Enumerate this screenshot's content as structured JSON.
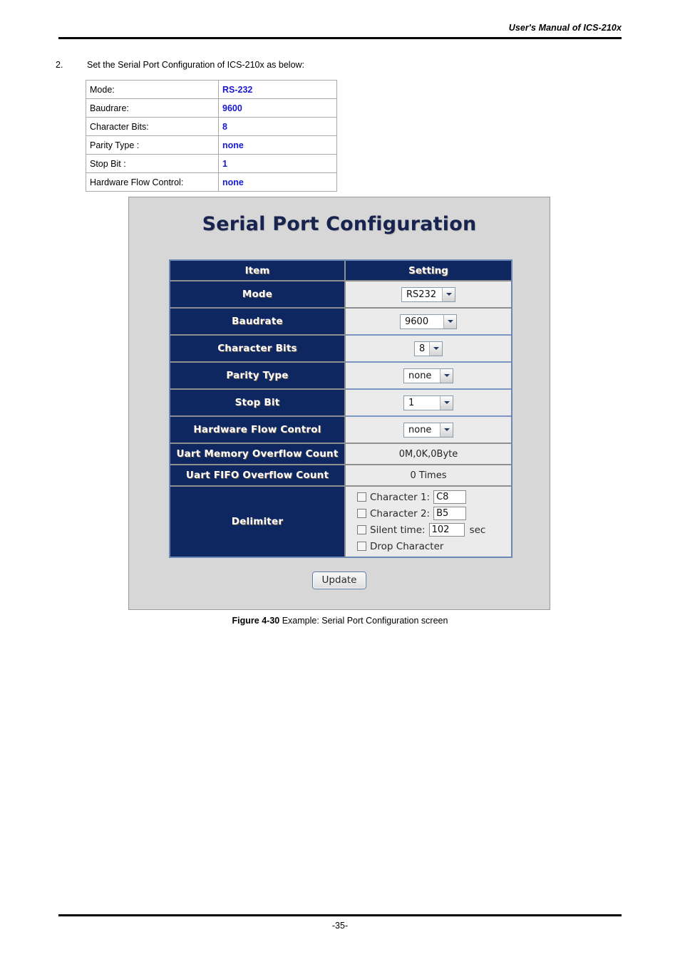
{
  "header": {
    "manual_title": "User's Manual of ICS-210x"
  },
  "step": {
    "number": "2.",
    "text": "Set the Serial Port Configuration of ICS-210x as below:"
  },
  "summary_table": {
    "rows": [
      {
        "label": "Mode:",
        "value": "RS-232"
      },
      {
        "label": "Baudrare:",
        "value": "9600"
      },
      {
        "label": "Character Bits:",
        "value": "8"
      },
      {
        "label": "Parity Type :",
        "value": "none"
      },
      {
        "label": "Stop Bit :",
        "value": "1"
      },
      {
        "label": "Hardware Flow Control:",
        "value": "none"
      }
    ]
  },
  "screenshot": {
    "title": "Serial Port Configuration",
    "columns": {
      "item": "Item",
      "setting": "Setting"
    },
    "rows": {
      "mode": {
        "label": "Mode",
        "value": "RS232"
      },
      "baudrate": {
        "label": "Baudrate",
        "value": "9600"
      },
      "character_bits": {
        "label": "Character Bits",
        "value": "8"
      },
      "parity_type": {
        "label": "Parity Type",
        "value": "none"
      },
      "stop_bit": {
        "label": "Stop Bit",
        "value": "1"
      },
      "hardware_flow_control": {
        "label": "Hardware Flow Control",
        "value": "none"
      },
      "uart_memory_overflow": {
        "label": "Uart Memory Overflow Count",
        "value": "0M,0K,0Byte"
      },
      "uart_fifo_overflow": {
        "label": "Uart FIFO Overflow Count",
        "value": "0 Times"
      },
      "delimiter": {
        "label": "Delimiter",
        "character1_label": "Character 1:",
        "character1_value": "C8",
        "character2_label": "Character 2:",
        "character2_value": "B5",
        "silent_time_label": "Silent time:",
        "silent_time_value": "102",
        "silent_time_unit": "sec",
        "drop_character_label": "Drop Character"
      }
    },
    "update_button": "Update",
    "colors": {
      "header_navy": "#0f2760",
      "setting_bg": "#ebebeb",
      "frame_bg": "#d7d7d7",
      "title_navy": "#18244f"
    }
  },
  "caption": {
    "figure_number": "Figure 4-30",
    "text": " Example: Serial Port Configuration screen"
  },
  "footer": {
    "page_number": "-35-"
  }
}
